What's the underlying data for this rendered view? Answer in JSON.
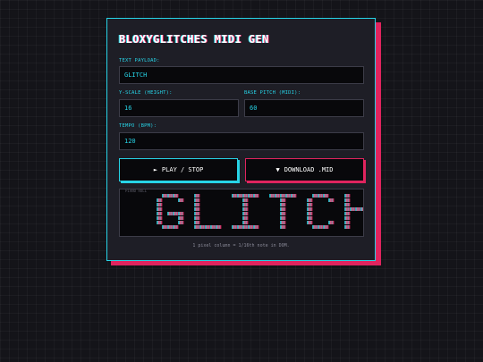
{
  "app": {
    "title": "BLOXYGLITCHES MIDI GEN"
  },
  "form": {
    "text_payload": {
      "label": "TEXT PAYLOAD:",
      "value": "GLITCH"
    },
    "y_scale": {
      "label": "Y-SCALE (HEIGHT):",
      "value": "16"
    },
    "base_pitch": {
      "label": "BASE PITCH (MIDI):",
      "value": "60"
    },
    "tempo": {
      "label": "TEMPO (BPM):",
      "value": "120"
    }
  },
  "buttons": {
    "play": {
      "icon": "play-icon",
      "glyph": "►",
      "label": "PLAY / STOP"
    },
    "download": {
      "icon": "download-icon",
      "glyph": "▼",
      "label": "DOWNLOAD .MID"
    }
  },
  "preview": {
    "label": "PIANO ROLL",
    "text": "GLITCH",
    "caption": "1 pixel column = 1/16th note in DOM.",
    "colors": {
      "note": "#e0245e",
      "echo": "#27d3e6",
      "dim": "#c3c3cf"
    }
  },
  "colors": {
    "accent_cyan": "#27d3e6",
    "accent_pink": "#e0245e",
    "panel": "#1e1e26",
    "background": "#141419"
  }
}
